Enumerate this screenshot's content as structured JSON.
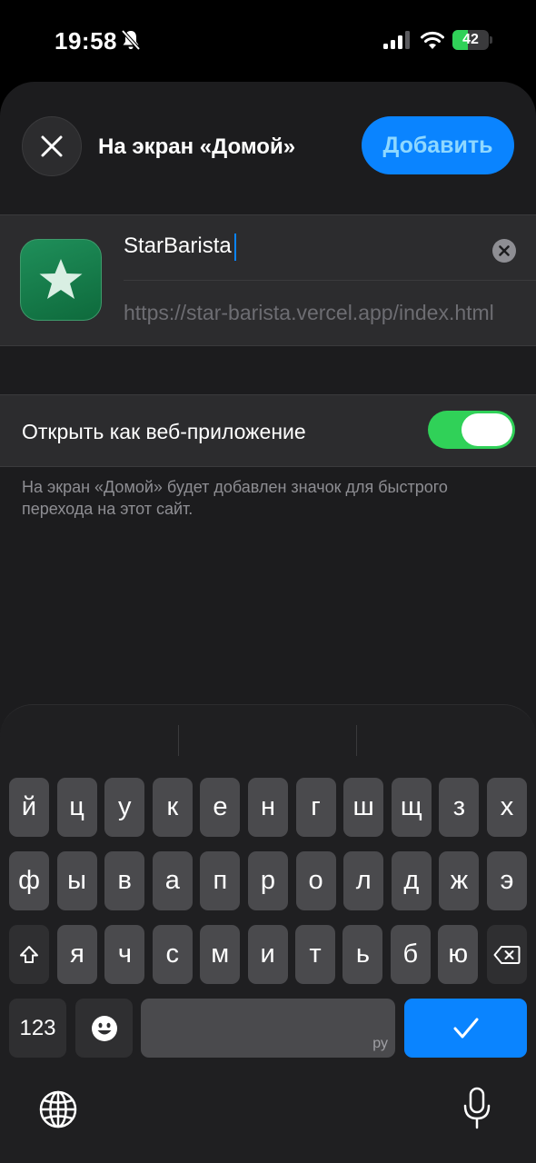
{
  "status": {
    "time": "19:58",
    "battery_level": "42",
    "battery_fraction": 0.42,
    "battery_color": "#30d158"
  },
  "sheet": {
    "title": "На экран «Домой»",
    "add_label": "Добавить",
    "accent": "#0a84ff",
    "app_name": "StarBarista",
    "app_url": "https://star-barista.vercel.app/index.html",
    "webapp_label": "Открыть как веб-приложение",
    "webapp_enabled": true,
    "hint": "На экран «Домой» будет добавлен значок для быстрого перехода на этот сайт."
  },
  "icons": {
    "close": "close-icon",
    "clear": "clear-x-icon",
    "app": "star-icon",
    "bell": "bell-slash-icon",
    "signal": "cellular-signal-icon",
    "wifi": "wifi-icon",
    "shift": "shift-icon",
    "delete": "delete-backspace-icon",
    "emoji": "emoji-icon",
    "globe": "globe-icon",
    "mic": "microphone-icon",
    "return": "checkmark-icon"
  },
  "keyboard": {
    "row1": [
      "й",
      "ц",
      "у",
      "к",
      "е",
      "н",
      "г",
      "ш",
      "щ",
      "з",
      "х"
    ],
    "row2": [
      "ф",
      "ы",
      "в",
      "а",
      "п",
      "р",
      "о",
      "л",
      "д",
      "ж",
      "э"
    ],
    "row3": [
      "я",
      "ч",
      "с",
      "м",
      "и",
      "т",
      "ь",
      "б",
      "ю"
    ],
    "numbers_label": "123",
    "space_hint": "ру"
  }
}
